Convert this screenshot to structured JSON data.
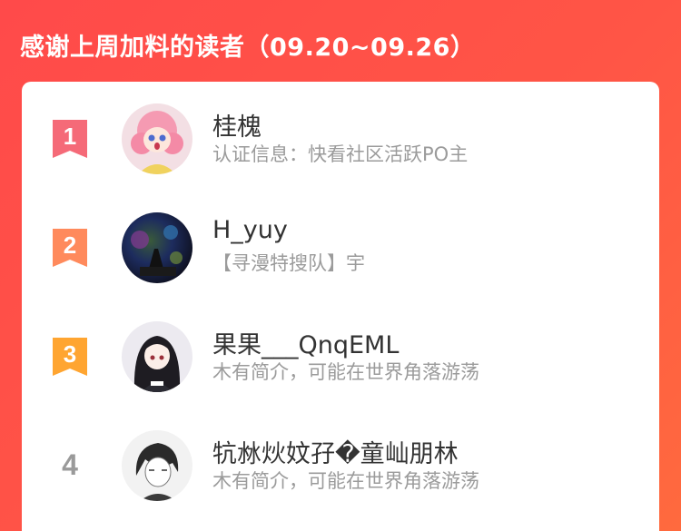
{
  "title": "感谢上周加料的读者（09.20~09.26）",
  "colors": {
    "background": "#ff4d46",
    "rank1": "#f56a78",
    "rank2": "#ff8a5c",
    "rank3": "#ffa531",
    "rank_plain": "#9a9a9a"
  },
  "readers": [
    {
      "rank": "1",
      "name": "桂槐",
      "desc": "认证信息：快看社区活跃PO主",
      "avatar_icon": "anime-girl-pink-hair-avatar"
    },
    {
      "rank": "2",
      "name": "H_yuy",
      "desc": "【寻漫特搜队】宇",
      "avatar_icon": "dark-night-scene-avatar"
    },
    {
      "rank": "3",
      "name": "果果___QnqEML",
      "desc": "木有简介，可能在世界角落游荡",
      "avatar_icon": "anime-girl-black-hair-avatar"
    },
    {
      "rank": "4",
      "name": "牨沝炏妏孖�童屾朋林",
      "desc": "木有简介，可能在世界角落游荡",
      "avatar_icon": "anime-boy-sketch-avatar"
    }
  ]
}
